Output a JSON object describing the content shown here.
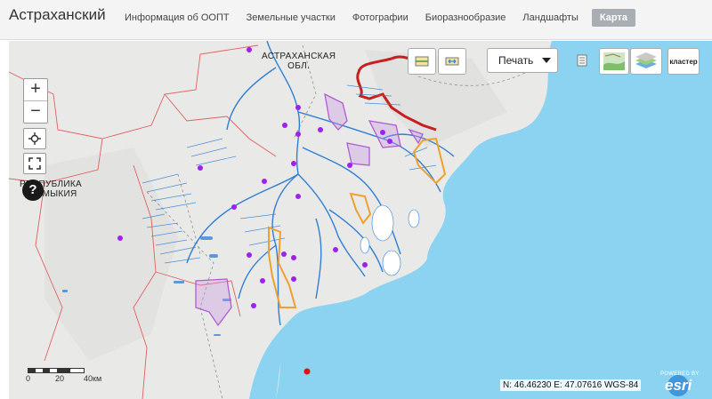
{
  "header": {
    "title": "Астраханский",
    "nav": [
      {
        "label": "Информация об ООПТ",
        "active": false
      },
      {
        "label": "Земельные участки",
        "active": false
      },
      {
        "label": "Фотографии",
        "active": false
      },
      {
        "label": "Биоразнообразие",
        "active": false
      },
      {
        "label": "Ландшафты",
        "active": false
      },
      {
        "label": "Карта",
        "active": true
      }
    ]
  },
  "map": {
    "zoom_in": "+",
    "zoom_out": "−",
    "help": "?",
    "print_label": "Печать",
    "cluster_label": "кластер",
    "region_labels": {
      "astrakhan_line1": "АСТРАХАНСКАЯ",
      "astrakhan_line2": "ОБЛ.",
      "kalmykia_line1": "РЕСПУБЛИКА",
      "kalmykia_line2": "КАЛМЫКИЯ"
    },
    "scale": {
      "t0": "0",
      "t1": "20",
      "t2": "40км"
    },
    "coordinates": "N: 46.46230 E: 47.07616 WGS-84",
    "attribution_top": "POWERED BY",
    "attribution_name": "esri",
    "colors": {
      "sea": "#8cd3f2",
      "land": "#e9e9e7",
      "water": "#2f7fd6",
      "boundary_red": "#c71f1f",
      "admin_border": "#e06060",
      "purple_area": "#b05bd6",
      "orange_area": "#f0a030",
      "poi_purple": "#a020f0",
      "poi_red": "#e01010"
    }
  }
}
